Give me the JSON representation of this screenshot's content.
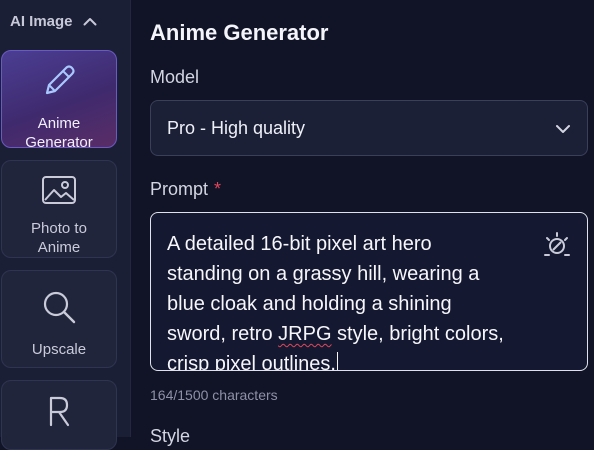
{
  "sidebar": {
    "section_title": "AI Image",
    "items": [
      {
        "label_lines": [
          "Anime",
          "Generator"
        ],
        "icon": "pencil-icon",
        "active": true
      },
      {
        "label_lines": [
          "Photo to",
          "Anime"
        ],
        "icon": "image-icon",
        "active": false
      },
      {
        "label_lines": [
          "Upscale"
        ],
        "icon": "search-icon",
        "active": false
      },
      {
        "label_lines": [
          ""
        ],
        "icon": "letter-r-icon",
        "active": false
      }
    ]
  },
  "main": {
    "title": "Anime Generator",
    "model": {
      "label": "Model",
      "value": "Pro - High quality"
    },
    "prompt": {
      "label": "Prompt",
      "required_mark": "*",
      "text_before": "A detailed 16-bit pixel art hero\nstanding on a grassy hill, wearing a\nblue cloak and holding a shining\nsword, retro ",
      "misspelled": "JRPG",
      "text_after": " style, bright colors,\ncrisp pixel outlines."
    },
    "counter": "164/1500 characters",
    "next_label": "Style"
  },
  "colors": {
    "background": "#111426",
    "sidebar": "#1b1f35",
    "active_tile": "#4b3e93",
    "required": "#e0475c",
    "accent_icon": "#a9c8ff"
  }
}
